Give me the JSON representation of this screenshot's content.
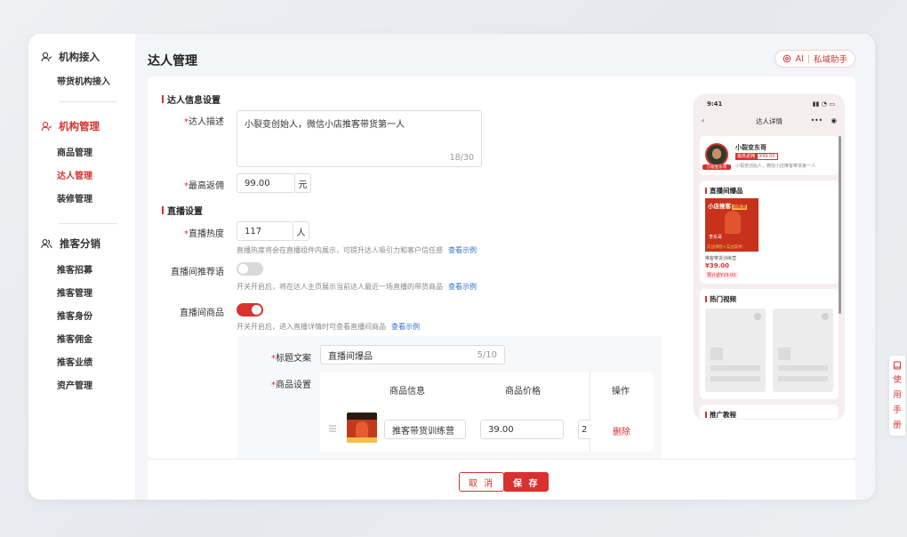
{
  "sidebar": {
    "groups": [
      {
        "title": "机构接入",
        "icon": "user-icon",
        "items": [
          "带货机构接入"
        ]
      },
      {
        "title": "机构管理",
        "icon": "user-icon",
        "items": [
          "商品管理",
          "达人管理",
          "装修管理"
        ]
      },
      {
        "title": "推客分销",
        "icon": "users-icon",
        "items": [
          "推客招募",
          "推客管理",
          "推客身份",
          "推客佣金",
          "推客业绩",
          "资产管理"
        ]
      }
    ]
  },
  "header": {
    "title": "达人管理",
    "ai_prefix": "AI",
    "ai_label": "私域助手"
  },
  "form": {
    "section1_title": "达人信息设置",
    "desc_label": "达人描述",
    "desc_value": "小裂变创始人，微信小店推客带货第一人",
    "desc_count": "18/30",
    "commission_label": "最高返佣",
    "commission_value": "99.00",
    "commission_unit": "元",
    "section2_title": "直播设置",
    "heat_label": "直播热度",
    "heat_value": "117",
    "heat_unit": "人",
    "heat_hint": "直播热度将会在直播组件内展示，可提升达人吸引力和客户信任感",
    "see_example": "查看示例",
    "recommend_label": "直播间推荐语",
    "recommend_on": false,
    "recommend_hint": "开关开启后，将在达人主页展示当前达人最近一场直播的带货商品",
    "goods_label": "直播间商品",
    "goods_on": true,
    "goods_hint": "开关开启后，进入直播详情时可查看直播间商品",
    "title_copy_label": "标题文案",
    "title_copy_value": "直播间爆品",
    "title_copy_count": "5/10",
    "goods_setting_label": "商品设置",
    "table": {
      "headers": [
        "商品信息",
        "商品价格",
        "操作"
      ],
      "rows": [
        {
          "name": "推客带货训练营",
          "price": "39.00",
          "extra": "2",
          "action": "删除"
        }
      ]
    }
  },
  "footer": {
    "cancel": "取 消",
    "save": "保 存"
  },
  "phone": {
    "time": "9:41",
    "nav_title": "达人详情",
    "profile_name": "小裂变东哥",
    "badge_a": "最高返佣",
    "badge_b": "¥99.00",
    "profile_desc": "小裂变创始人，微信小店推客带货第一人",
    "avatar_tag": "小裂变东哥",
    "hot_title": "直播间爆品",
    "product_banner": "小店推客",
    "product_banner_tag": "训练营",
    "product_person": "李东哥",
    "product_sub": "实战课程+实战案例",
    "product_name": "推客带货训练营",
    "product_price": "¥39.00",
    "product_earn": "预计返¥29.00",
    "video_title": "热门视频",
    "tutorial_title": "推广教程"
  },
  "side_tab": {
    "chars": [
      "使",
      "用",
      "手",
      "册"
    ]
  },
  "colors": {
    "accent": "#d7322e",
    "link": "#2f6fd6"
  }
}
